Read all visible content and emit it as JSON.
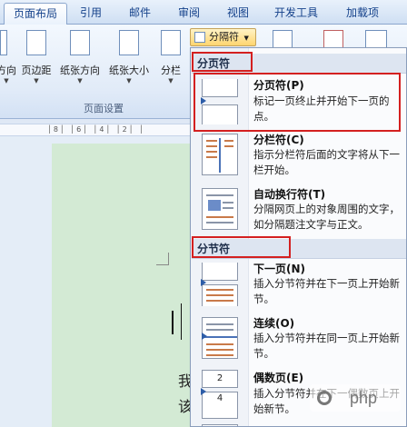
{
  "tabs": [
    {
      "label": "页面布局",
      "active": true
    },
    {
      "label": "引用",
      "active": false
    },
    {
      "label": "邮件",
      "active": false
    },
    {
      "label": "审阅",
      "active": false
    },
    {
      "label": "视图",
      "active": false
    },
    {
      "label": "开发工具",
      "active": false
    },
    {
      "label": "加载项",
      "active": false
    }
  ],
  "ribbon": {
    "buttons": [
      "方向",
      "页边距",
      "纸张方向",
      "纸张大小",
      "分栏"
    ],
    "separator_button": "分隔符",
    "group_label": "页面设置"
  },
  "ruler": {
    "text": "│8│ │6│ │4│ │2│ │"
  },
  "document": {
    "line1": "我",
    "line2": "该"
  },
  "menu": {
    "page_break_header": "分页符",
    "section_break_header": "分节符",
    "items": [
      {
        "title": "分页符(P)",
        "desc": "标记一页终止并开始下一页的点。"
      },
      {
        "title": "分栏符(C)",
        "desc": "指示分栏符后面的文字将从下一栏开始。"
      },
      {
        "title": "自动换行符(T)",
        "desc": "分隔网页上的对象周围的文字，如分隔题注文字与正文。"
      },
      {
        "title": "下一页(N)",
        "desc": "插入分节符并在下一页上开始新节。"
      },
      {
        "title": "连续(O)",
        "desc": "插入分节符并在同一页上开始新节。"
      },
      {
        "title": "偶数页(E)",
        "desc": "插入分节符并在下一偶数页上开始新节。"
      }
    ],
    "even_page_thumb_digits": [
      "2",
      "4"
    ]
  },
  "watermark": {
    "text": "php"
  },
  "colors": {
    "highlight_box": "#d42020",
    "accent": "#15428b"
  }
}
